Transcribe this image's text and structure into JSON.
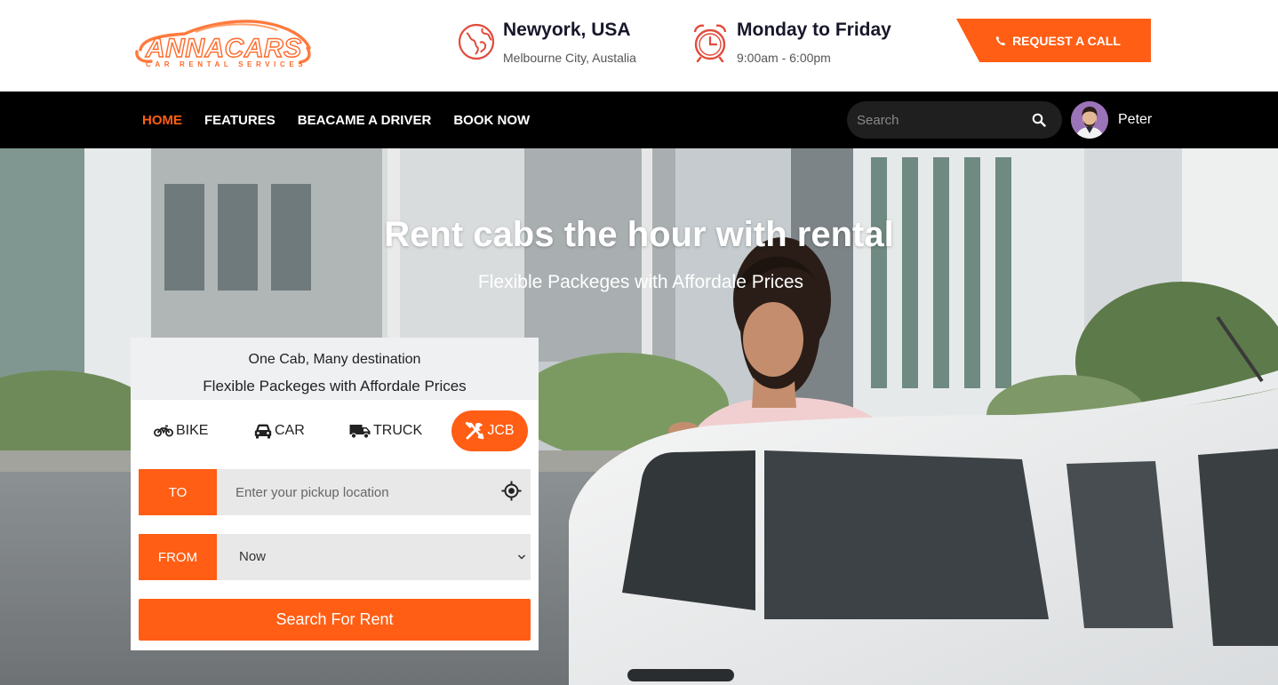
{
  "brand": {
    "logo_text": "ANNACARS",
    "logo_tagline": "CAR RENTAL SERVICES"
  },
  "header": {
    "location": {
      "title": "Newyork, USA",
      "subtitle": "Melbourne City, Austalia",
      "icon": "globe-icon"
    },
    "hours": {
      "title": "Monday to Friday",
      "subtitle": "9:00am - 6:00pm",
      "icon": "alarm-clock-icon"
    },
    "request_call_label": "REQUEST A CALL"
  },
  "nav": {
    "items": [
      {
        "label": "HOME",
        "active": true
      },
      {
        "label": "FEATURES",
        "active": false
      },
      {
        "label": "BEACAME A DRIVER",
        "active": false
      },
      {
        "label": "BOOK NOW",
        "active": false
      }
    ],
    "search_placeholder": "Search",
    "user_name": "Peter"
  },
  "hero": {
    "title": "Rent cabs the hour with rental",
    "tagline": "Flexible Packeges with Affordale Prices"
  },
  "booking": {
    "heading_line1": "One Cab, Many destination",
    "heading_line2": "Flexible Packeges with Affordale Prices",
    "tabs": [
      {
        "label": "BIKE",
        "icon": "motorcycle-icon",
        "active": false
      },
      {
        "label": "CAR",
        "icon": "car-icon",
        "active": false
      },
      {
        "label": "TRUCK",
        "icon": "truck-icon",
        "active": false
      },
      {
        "label": "JCB",
        "icon": "tools-icon",
        "active": true
      }
    ],
    "to_label": "TO",
    "to_placeholder": "Enter your pickup location",
    "from_label": "FROM",
    "from_value": "Now",
    "search_button": "Search For Rent"
  },
  "colors": {
    "accent": "#ff5e14",
    "nav_bg": "#000000",
    "text_dark": "#17172a"
  }
}
